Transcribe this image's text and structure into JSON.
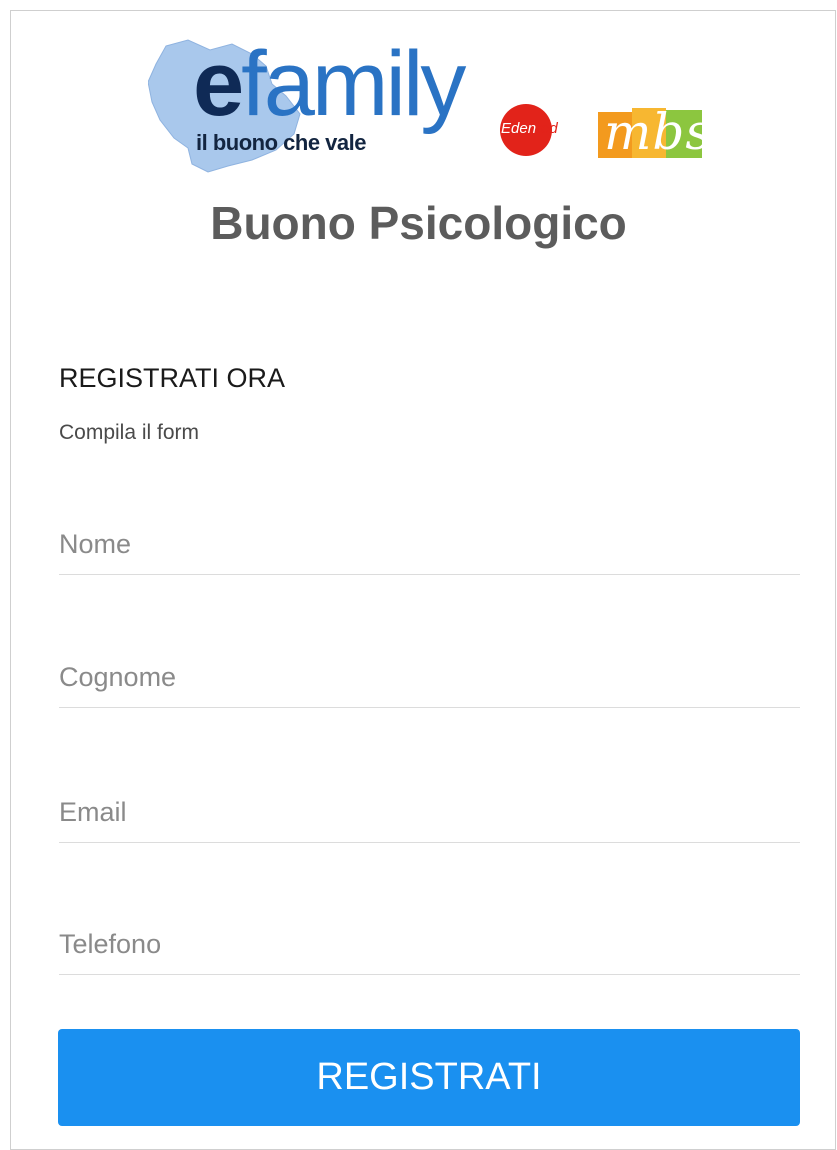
{
  "brand": {
    "logo_word": "efamily",
    "logo_first_letter": "e",
    "logo_rest": "family",
    "tagline": "il buono che vale",
    "partner_1": "Edenred",
    "partner_1_part_a": "Eden",
    "partner_1_part_b": "red",
    "partner_2": "mbs"
  },
  "page": {
    "title": "Buono Psicologico"
  },
  "form": {
    "heading": "REGISTRATI ORA",
    "instruction": "Compila il form",
    "fields": [
      {
        "placeholder": "Nome",
        "value": ""
      },
      {
        "placeholder": "Cognome",
        "value": ""
      },
      {
        "placeholder": "Email",
        "value": ""
      },
      {
        "placeholder": "Telefono",
        "value": ""
      }
    ],
    "submit_label": "REGISTRATI"
  },
  "colors": {
    "primary_button": "#1a90f0",
    "logo_blue": "#2a73c4",
    "logo_navy": "#0f2a56",
    "edenred_red": "#e2231a",
    "mbs_orange": "#f39a1e",
    "mbs_green": "#8cc63f",
    "title_gray": "#5c5c5c"
  }
}
